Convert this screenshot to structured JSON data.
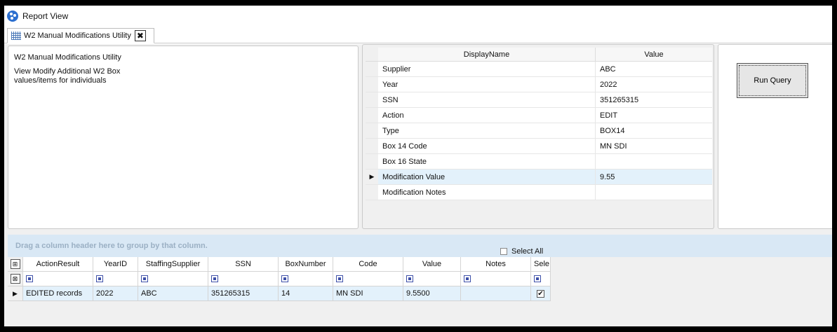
{
  "window": {
    "title": "Report View"
  },
  "tab": {
    "label": "W2 Manual Modifications Utility",
    "close_glyph": "✖"
  },
  "description": {
    "title": "W2 Manual Modifications Utility",
    "text": "View  Modify Additional W2 Box values/items for individuals"
  },
  "properties": {
    "header": {
      "name": "DisplayName",
      "value": "Value"
    },
    "rows": [
      {
        "name": "Supplier",
        "value": "ABC"
      },
      {
        "name": "Year",
        "value": "2022"
      },
      {
        "name": "SSN",
        "value": "351265315"
      },
      {
        "name": "Action",
        "value": "EDIT"
      },
      {
        "name": "Type",
        "value": "BOX14"
      },
      {
        "name": "Box 14 Code",
        "value": "MN SDI"
      },
      {
        "name": "Box 16 State",
        "value": ""
      },
      {
        "name": "Modification Value",
        "value": "9.55"
      },
      {
        "name": "Modification Notes",
        "value": ""
      }
    ],
    "current_row_index": 7
  },
  "run_query": {
    "label": "Run Query"
  },
  "grid": {
    "group_hint": "Drag a column header here to group by that column.",
    "select_all_label": "Select All",
    "columns": [
      "ActionResult",
      "YearID",
      "StaffingSupplier",
      "SSN",
      "BoxNumber",
      "Code",
      "Value",
      "Notes",
      "Sele"
    ],
    "rows": [
      [
        "EDITED records",
        "2022",
        "ABC",
        "351265315",
        "14",
        "MN SDI",
        "9.5500",
        "",
        ""
      ]
    ],
    "row_selected": true
  },
  "colors": {
    "accent": "#2c6fcf",
    "selection": "#e3f1fb",
    "group_bar": "#d9e8f5"
  }
}
